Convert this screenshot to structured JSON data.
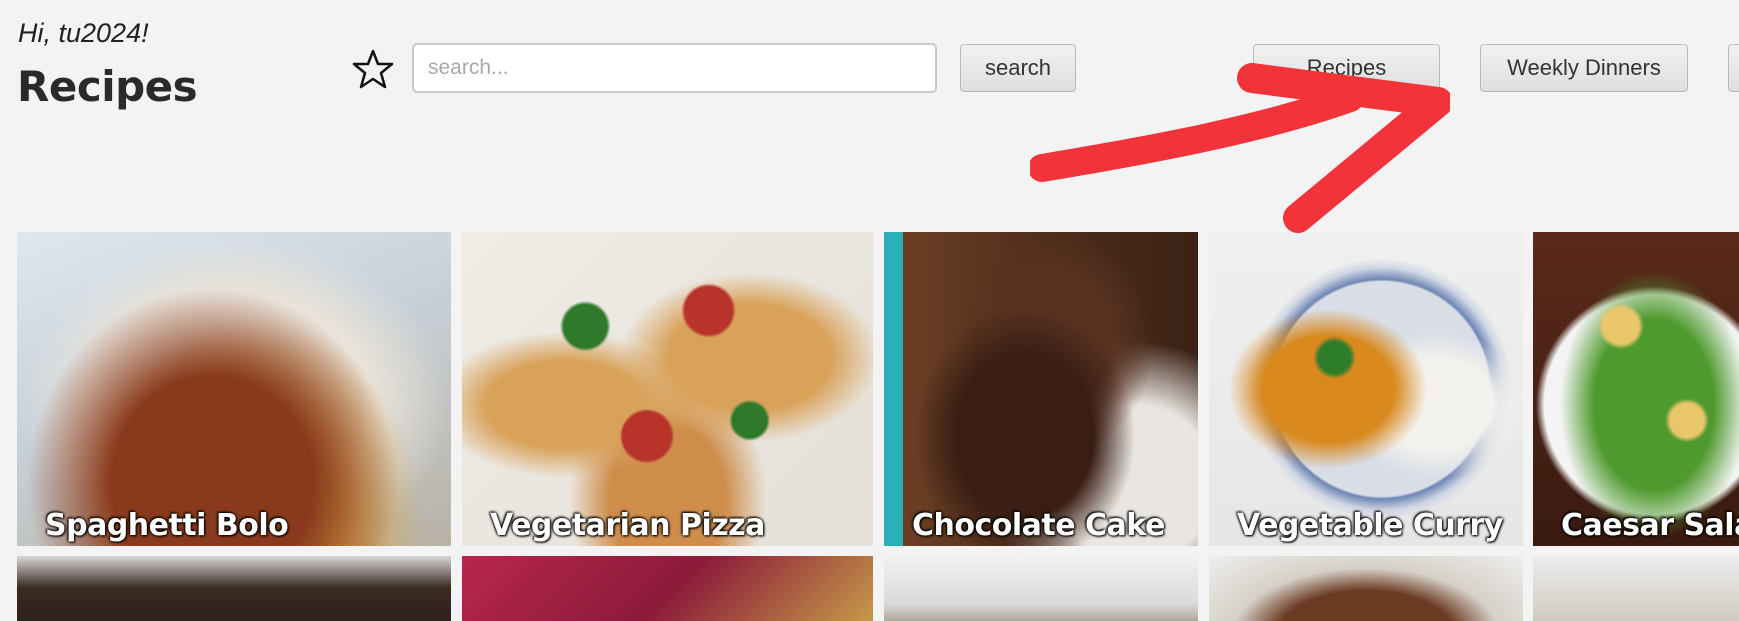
{
  "header": {
    "greeting": "Hi, tu2024!",
    "title": "Recipes"
  },
  "search": {
    "placeholder": "search...",
    "button_label": "search"
  },
  "nav": {
    "recipes_button_label": "Recipes",
    "weekly_dinners_label": "Weekly Dinners"
  },
  "icons": {
    "favorite": "star-outline-icon",
    "annotation": "arrow-annotation"
  },
  "colors": {
    "background": "#f3f3f3",
    "annotation_arrow": "#f2333a"
  },
  "recipes": [
    {
      "title": "Spaghetti Bolo"
    },
    {
      "title": "Vegetarian Pizza"
    },
    {
      "title": "Chocolate Cake"
    },
    {
      "title": "Vegetable Curry"
    },
    {
      "title": "Caesar Salad"
    }
  ]
}
